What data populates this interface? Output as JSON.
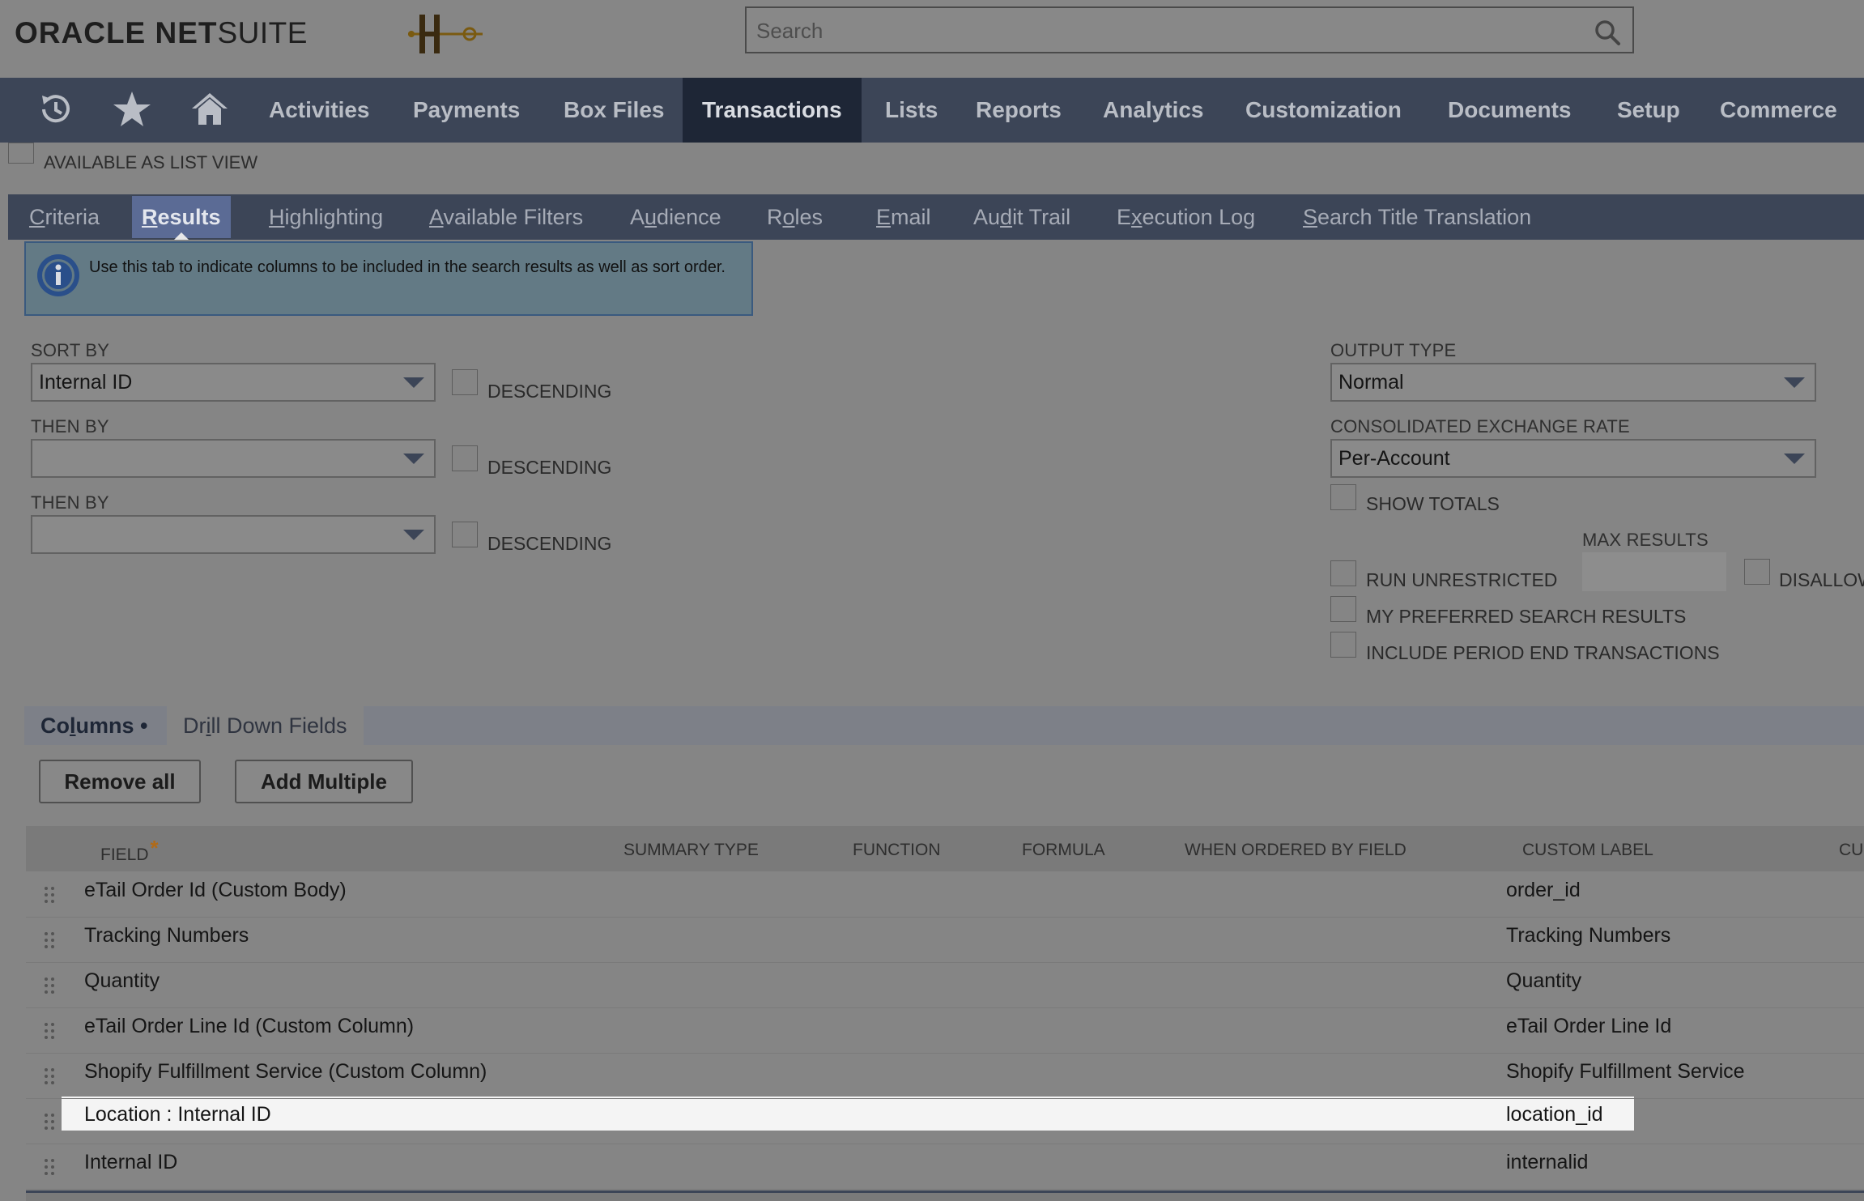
{
  "header": {
    "logo_bold": "ORACLE NET",
    "logo_light": "SUITE",
    "search": {
      "placeholder": "Search"
    }
  },
  "nav": {
    "items": [
      "Activities",
      "Payments",
      "Box Files",
      "Transactions",
      "Lists",
      "Reports",
      "Analytics",
      "Customization",
      "Documents",
      "Setup",
      "Commerce"
    ],
    "active": "Transactions"
  },
  "available_as_list_view": "AVAILABLE AS LIST VIEW",
  "subtabs": {
    "items": [
      {
        "first": "C",
        "rest": "riteria",
        "ul_pos": "start"
      },
      {
        "first": "R",
        "rest": "esults",
        "ul_pos": "start"
      },
      {
        "first": "H",
        "rest": "ighlighting",
        "ul_pos": "start"
      },
      {
        "first": "A",
        "rest": "vailable Filters",
        "ul_pos": "start"
      },
      {
        "pre": "A",
        "ul": "u",
        "post": "dience"
      },
      {
        "pre": "R",
        "ul": "o",
        "post": "les"
      },
      {
        "first": "E",
        "rest": "mail",
        "ul_pos": "start"
      },
      {
        "pre": "Au",
        "ul": "d",
        "post": "it Trail"
      },
      {
        "pre": "E",
        "ul": "x",
        "post": "ecution Log"
      },
      {
        "first": "S",
        "rest": "earch Title Translation",
        "ul_pos": "start"
      }
    ],
    "active_index": 1
  },
  "info_text": "Use this tab to indicate columns to be included in the search results as well as sort order.",
  "sort": {
    "sort_by_label": "SORT BY",
    "sort_by_value": "Internal ID",
    "then_by_label_1": "THEN BY",
    "then_by_value_1": "",
    "then_by_label_2": "THEN BY",
    "then_by_value_2": "",
    "descending_label": "DESCENDING"
  },
  "output": {
    "output_type_label": "OUTPUT TYPE",
    "output_type_value": "Normal",
    "exchange_rate_label": "CONSOLIDATED EXCHANGE RATE",
    "exchange_rate_value": "Per-Account",
    "show_totals": "SHOW TOTALS",
    "max_results_label": "MAX RESULTS",
    "run_unrestricted": "RUN UNRESTRICTED",
    "disallow": "DISALLOW",
    "my_preferred": "MY PREFERRED SEARCH RESULTS",
    "include_period_end": "INCLUDE PERIOD END TRANSACTIONS"
  },
  "columns_tabs": {
    "columns_pre": "Co",
    "columns_ul": "l",
    "columns_post": "umns •",
    "drill_pre": "Dr",
    "drill_ul": "i",
    "drill_post": "ll Down Fields"
  },
  "buttons": {
    "remove_all": "Remove all",
    "add_multiple": "Add Multiple"
  },
  "table": {
    "headers": [
      "FIELD",
      "SUMMARY TYPE",
      "FUNCTION",
      "FORMULA",
      "WHEN ORDERED BY FIELD",
      "CUSTOM LABEL",
      "CU"
    ],
    "rows": [
      {
        "field": "eTail Order Id (Custom Body)",
        "label": "order_id"
      },
      {
        "field": "Tracking Numbers",
        "label": "Tracking Numbers"
      },
      {
        "field": "Quantity",
        "label": "Quantity"
      },
      {
        "field": "eTail Order Line Id (Custom Column)",
        "label": "eTail Order Line Id"
      },
      {
        "field": "Shopify Fulfillment Service (Custom Column)",
        "label": "Shopify Fulfillment Service"
      },
      {
        "field": "Location : Internal ID",
        "label": "location_id"
      },
      {
        "field": "Internal ID",
        "label": "internalid"
      }
    ]
  },
  "colors": {
    "nav_bg": "#3c4557",
    "active_tab": "#1e2636",
    "results_tab": "#5b6b95"
  }
}
